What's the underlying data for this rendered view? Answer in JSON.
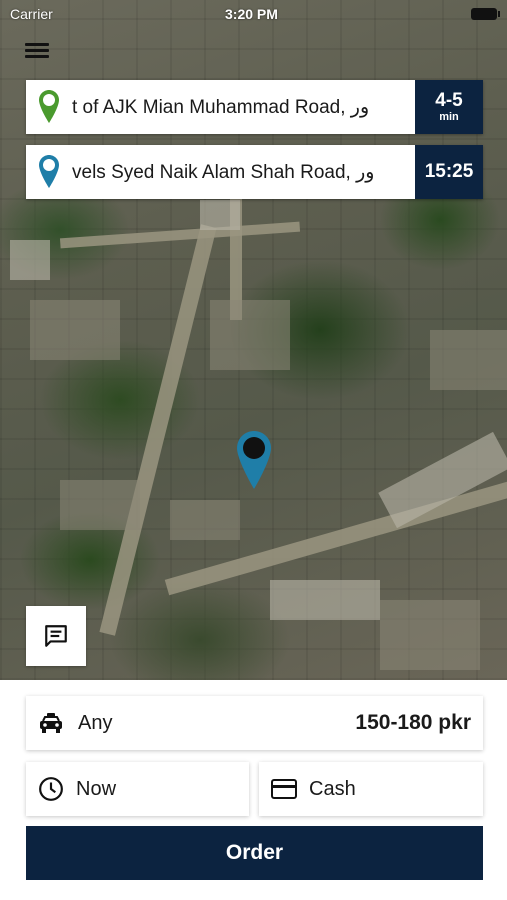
{
  "status_bar": {
    "carrier": "Carrier",
    "time": "3:20 PM"
  },
  "route": {
    "pickup": {
      "address": "t of AJK Mian Muhammad Road, ور",
      "eta_value": "4-5",
      "eta_unit": "min",
      "pin_color": "#4a9a2e"
    },
    "destination": {
      "address": "vels Syed Naik Alam Shah Road, ور",
      "arrival_time": "15:25",
      "pin_color": "#1f7ea8"
    }
  },
  "map": {
    "marker_color": "#1f7ea8",
    "marker_icon": "location-pin-icon"
  },
  "chat": {
    "icon": "message-icon"
  },
  "ride": {
    "vehicle_icon": "car-icon",
    "vehicle_type": "Any",
    "price": "150-180 pkr",
    "time_icon": "clock-icon",
    "time_label": "Now",
    "payment_icon": "credit-card-icon",
    "payment_label": "Cash"
  },
  "order_label": "Order",
  "colors": {
    "primary": "#0c2340",
    "pickup": "#4a9a2e",
    "destination": "#1f7ea8"
  }
}
